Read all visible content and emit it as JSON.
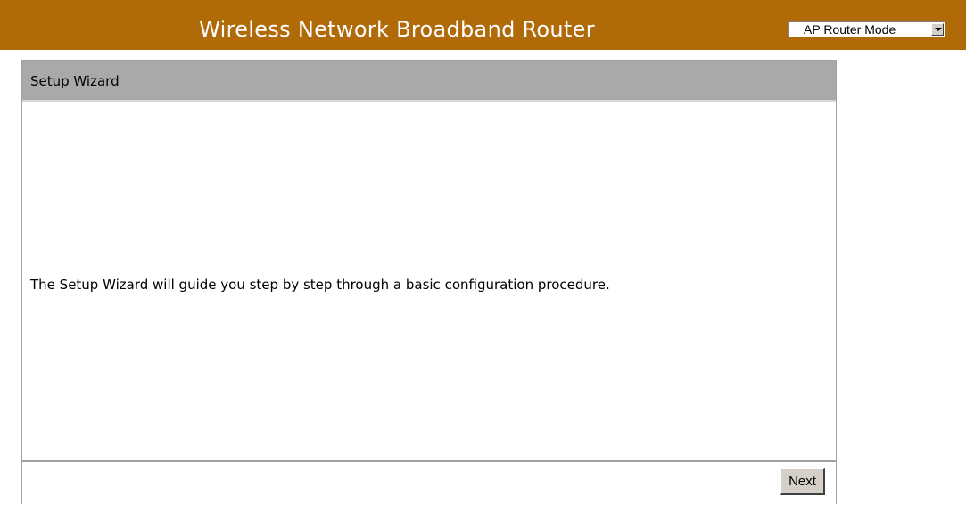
{
  "header": {
    "title": "Wireless Network Broadband Router",
    "background_color": "#b06a08",
    "mode_select": {
      "value": "AP Router Mode"
    }
  },
  "panel": {
    "title": "Setup Wizard",
    "header_color": "#a9a9a9",
    "body_text": "The Setup Wizard will guide you step by step through a basic configuration procedure.",
    "next_label": "Next"
  }
}
